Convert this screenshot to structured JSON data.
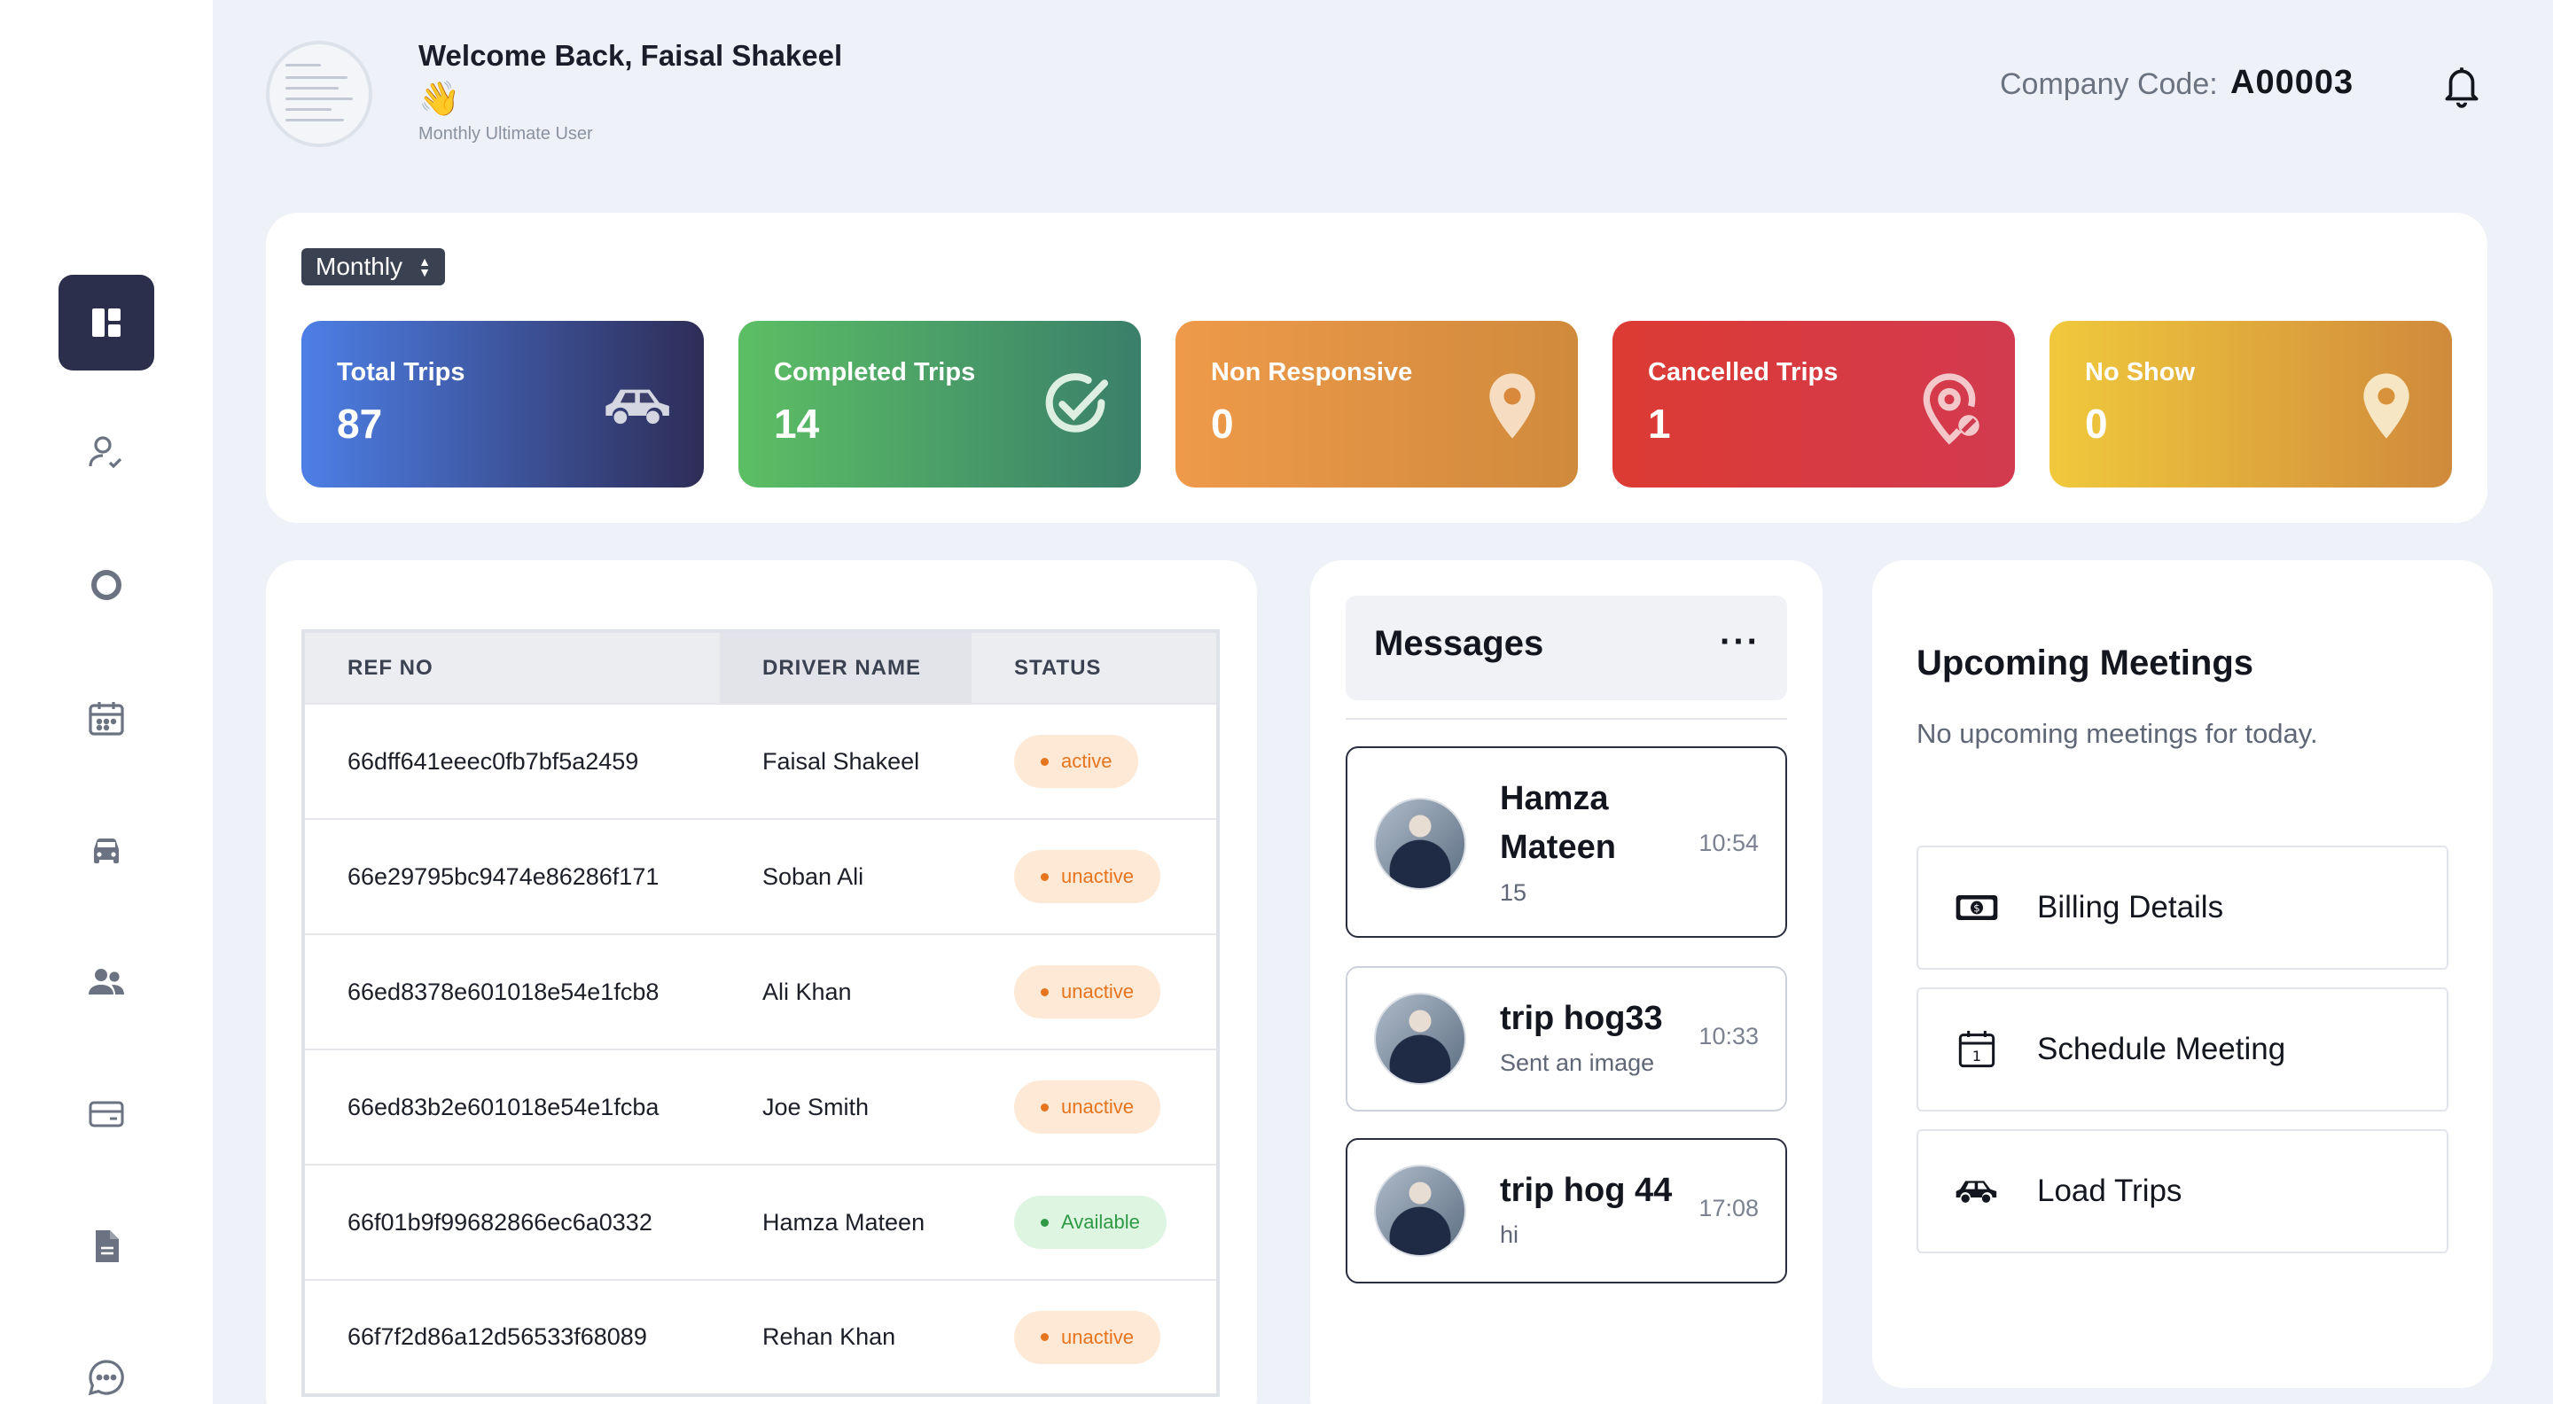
{
  "header": {
    "welcome_text": "Welcome Back, Faisal Shakeel",
    "wave_emoji": "👋",
    "user_type": "Monthly Ultimate User",
    "company_code_label": "Company Code:",
    "company_code_value": "A00003"
  },
  "sidebar": {
    "items": [
      {
        "icon": "dashboard-icon",
        "active": true
      },
      {
        "icon": "user-check-icon",
        "active": false
      },
      {
        "icon": "circle-icon",
        "active": false
      },
      {
        "icon": "calendar-icon",
        "active": false
      },
      {
        "icon": "car-icon",
        "active": false
      },
      {
        "icon": "users-icon",
        "active": false
      },
      {
        "icon": "card-icon",
        "active": false
      },
      {
        "icon": "document-icon",
        "active": false
      },
      {
        "icon": "chat-icon",
        "active": false
      }
    ]
  },
  "stats": {
    "period": "Monthly",
    "cards": [
      {
        "label": "Total Trips",
        "value": "87",
        "icon": "car-icon"
      },
      {
        "label": "Completed Trips",
        "value": "14",
        "icon": "check-circle-icon"
      },
      {
        "label": "Non Responsive",
        "value": "0",
        "icon": "map-pin-icon"
      },
      {
        "label": "Cancelled Trips",
        "value": "1",
        "icon": "location-off-icon"
      },
      {
        "label": "No Show",
        "value": "0",
        "icon": "map-pin-icon"
      }
    ]
  },
  "trips_table": {
    "headers": [
      "REF NO",
      "DRIVER NAME",
      "STATUS"
    ],
    "rows": [
      {
        "ref": "66dff641eeec0fb7bf5a2459",
        "driver": "Faisal Shakeel",
        "status": "active",
        "status_color": "#e5741d"
      },
      {
        "ref": "66e29795bc9474e86286f171",
        "driver": "Soban Ali",
        "status": "unactive",
        "status_color": "#e5741d"
      },
      {
        "ref": "66ed8378e601018e54e1fcb8",
        "driver": "Ali Khan",
        "status": "unactive",
        "status_color": "#e5741d"
      },
      {
        "ref": "66ed83b2e601018e54e1fcba",
        "driver": "Joe Smith",
        "status": "unactive",
        "status_color": "#e5741d"
      },
      {
        "ref": "66f01b9f99682866ec6a0332",
        "driver": "Hamza Mateen",
        "status": "Available",
        "status_color": "#2e9a45"
      },
      {
        "ref": "66f7f2d86a12d56533f68089",
        "driver": "Rehan Khan",
        "status": "unactive",
        "status_color": "#e5741d"
      }
    ]
  },
  "messages": {
    "title": "Messages",
    "more_label": "···",
    "items": [
      {
        "name": "Hamza Mateen",
        "preview": "15",
        "time": "10:54",
        "unread": true
      },
      {
        "name": "trip hog33",
        "preview": "Sent an image",
        "time": "10:33",
        "unread": false
      },
      {
        "name": "trip hog 44",
        "preview": "hi",
        "time": "17:08",
        "unread": true
      }
    ]
  },
  "meetings": {
    "title": "Upcoming Meetings",
    "empty_text": "No upcoming meetings for today.",
    "actions": [
      {
        "label": "Billing Details",
        "icon": "banknote-icon"
      },
      {
        "label": "Schedule Meeting",
        "icon": "calendar-icon"
      },
      {
        "label": "Load Trips",
        "icon": "car-icon"
      }
    ]
  }
}
